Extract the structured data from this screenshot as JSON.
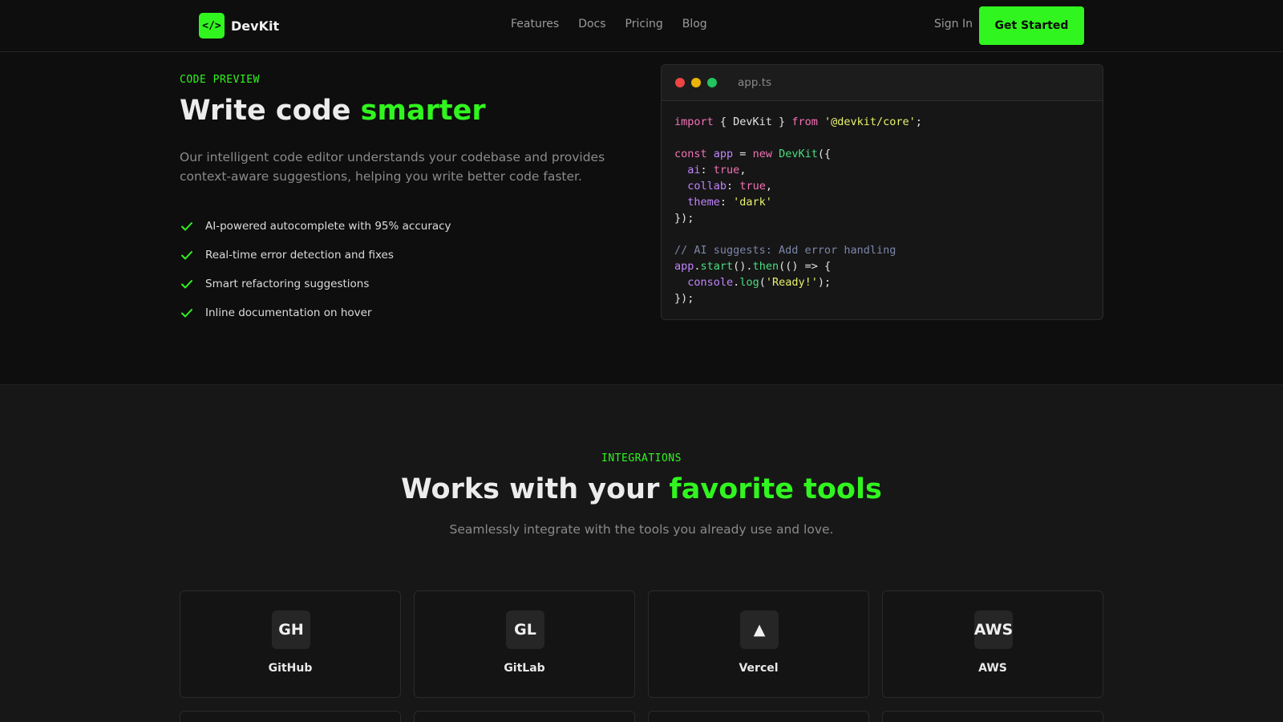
{
  "nav": {
    "logo_mark": "</>",
    "logo_text": "DevKit",
    "links": [
      "Features",
      "Docs",
      "Pricing",
      "Blog"
    ],
    "sign_in": "Sign In",
    "cta": "Get Started"
  },
  "hero": {
    "eyebrow": "CODE PREVIEW",
    "title_plain": "Write code ",
    "title_accent": "smarter",
    "description": "Our intelligent code editor understands your codebase and provides context-aware suggestions, helping you write better code faster.",
    "features": [
      "AI-powered autocomplete with 95% accuracy",
      "Real-time error detection and fixes",
      "Smart refactoring suggestions",
      "Inline documentation on hover"
    ]
  },
  "code_window": {
    "filename": "app.ts",
    "lines": [
      "import { DevKit } from '@devkit/core';",
      "",
      "const app = new DevKit({",
      "  ai: true,",
      "  collab: true,",
      "  theme: 'dark'",
      "});",
      "",
      "// AI suggests: Add error handling",
      "app.start().then(() => {",
      "  console.log('Ready!');",
      "});"
    ]
  },
  "integrations": {
    "eyebrow": "INTEGRATIONS",
    "title_plain": "Works with your ",
    "title_accent": "favorite tools",
    "subtitle": "Seamlessly integrate with the tools you already use and love.",
    "cards": [
      {
        "icon": "GH",
        "label": "GitHub"
      },
      {
        "icon": "GL",
        "label": "GitLab"
      },
      {
        "icon": "▲",
        "label": "Vercel"
      },
      {
        "icon": "AWS",
        "label": "AWS"
      }
    ]
  },
  "colors": {
    "accent": "#31f51f",
    "background": "#0e0e0e",
    "section_bg": "#171717",
    "dot_red": "#ef4444",
    "dot_yellow": "#eab308",
    "dot_green": "#22c55e"
  }
}
